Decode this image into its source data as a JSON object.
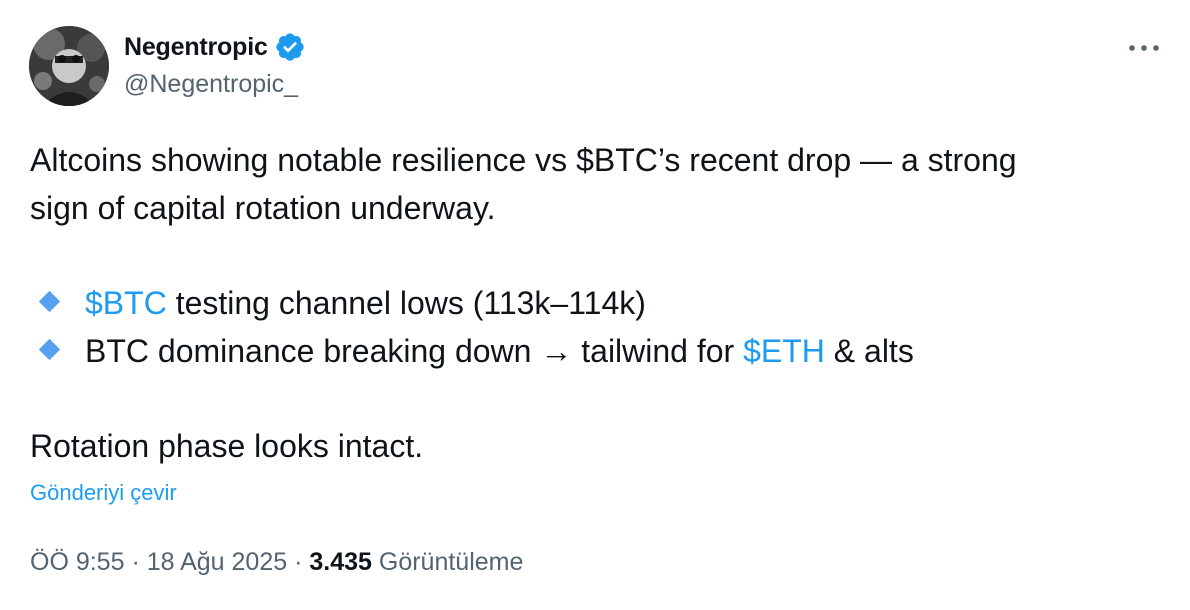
{
  "author": {
    "name": "Negentropic",
    "handle": "@Negentropic_"
  },
  "tweet": {
    "line1": "Altcoins showing notable resilience vs $BTC’s recent drop — a strong",
    "line2": "sign of capital rotation underway.",
    "bullets": [
      {
        "cashtag": "$BTC",
        "text": " testing channel lows (113k–114k)"
      },
      {
        "prefix": "BTC dominance breaking down → tailwind for ",
        "cashtag": "$ETH",
        "suffix": " & alts"
      }
    ],
    "closing": "Rotation phase looks intact."
  },
  "translate_label": "Gönderiyi çevir",
  "meta": {
    "time": "ÖÖ 9:55",
    "separator": " · ",
    "date": "18 Ağu 2025",
    "views_count": "3.435",
    "views_label": "Görüntüleme"
  },
  "icons": {
    "verified": "verified-badge-icon",
    "more": "more-options-icon",
    "bullet": "blue-diamond-icon"
  },
  "colors": {
    "accent": "#1d9bf0",
    "text": "#0f1419",
    "secondary": "#536471",
    "bullet_diamond": "#55a0f0"
  }
}
